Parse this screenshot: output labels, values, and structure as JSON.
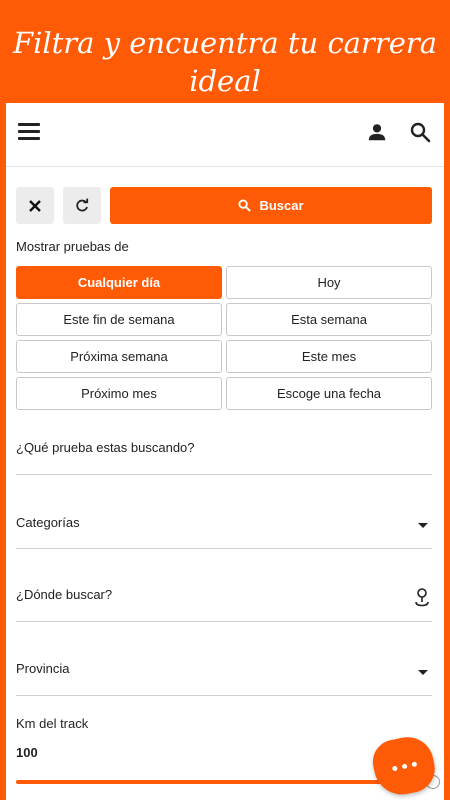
{
  "banner": {
    "line1": "Filtra y encuentra tu carrera",
    "line2": "ideal"
  },
  "toolbar": {
    "search_label": "Buscar"
  },
  "date_filter": {
    "label": "Mostrar pruebas de",
    "options": [
      "Cualquier día",
      "Hoy",
      "Este fin de semana",
      "Esta semana",
      "Próxima semana",
      "Este mes",
      "Próximo mes",
      "Escoge una fecha"
    ],
    "selected": "Cualquier día"
  },
  "fields": {
    "query_placeholder": "¿Qué prueba estas buscando?",
    "category_placeholder": "Categorías",
    "location_placeholder": "¿Dónde buscar?",
    "province_placeholder": "Provincia"
  },
  "distance": {
    "label": "Km del track",
    "value": "100"
  },
  "colors": {
    "accent": "#ff5a06"
  }
}
